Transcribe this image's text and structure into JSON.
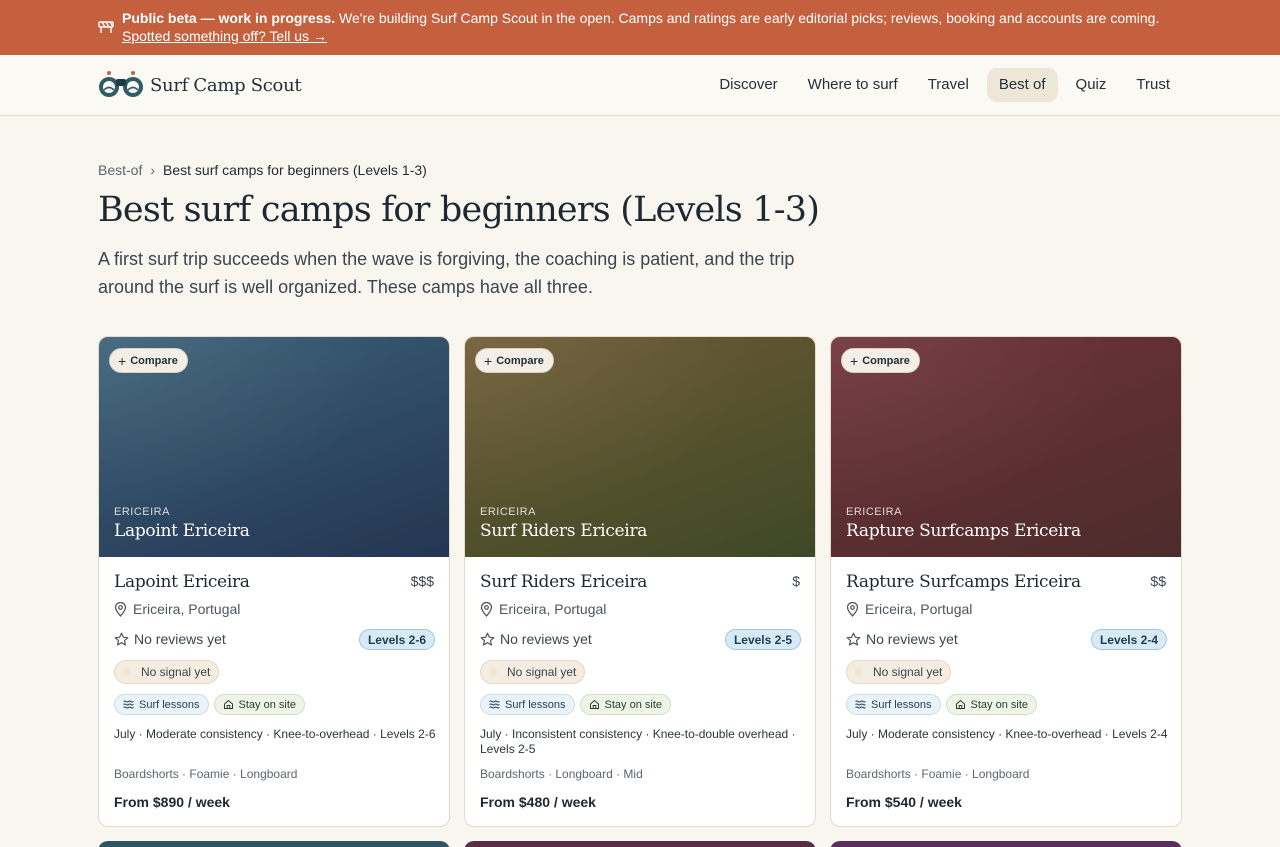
{
  "beta": {
    "icon": "construction-barrier-icon",
    "bold": "Public beta — work in progress.",
    "text": " We're building Surf Camp Scout in the open. Camps and ratings are early editorial picks; reviews, booking and accounts are coming.",
    "link": "Spotted something off? Tell us →",
    "bg": "#c5603f"
  },
  "brand": {
    "name": "Surf Camp Scout",
    "icon": "binoculars-logo-icon"
  },
  "nav": {
    "items": [
      {
        "label": "Discover",
        "active": false
      },
      {
        "label": "Where to surf",
        "active": false
      },
      {
        "label": "Travel",
        "active": false
      },
      {
        "label": "Best of",
        "active": true
      },
      {
        "label": "Quiz",
        "active": false
      },
      {
        "label": "Trust",
        "active": false
      }
    ]
  },
  "breadcrumb": {
    "root": "Best-of",
    "sep": "›",
    "current": "Best surf camps for beginners (Levels 1-3)"
  },
  "page": {
    "title": "Best surf camps for beginners (Levels 1-3)",
    "lede": "A first surf trip succeeds when the wave is forgiving, the coaching is patient, and the trip around the surf is well organized. These camps have all three."
  },
  "compare_label": "Compare",
  "cards": [
    {
      "region": "ERICEIRA",
      "name": "Lapoint Ericeira",
      "price": "$$$",
      "location": "Ericeira, Portugal",
      "reviews": "No reviews yet",
      "levels": "Levels 2-6",
      "signal": "No signal yet",
      "tag1": "Surf lessons",
      "tag2": "Stay on site",
      "meta": "July · Moderate consistency · Knee-to-overhead · Levels 2-6",
      "boards": "Boardshorts · Foamie · Longboard",
      "from": "From $890 / week",
      "colors": [
        "#3a6078",
        "#243552"
      ]
    },
    {
      "region": "ERICEIRA",
      "name": "Surf Riders Ericeira",
      "price": "$",
      "location": "Ericeira, Portugal",
      "reviews": "No reviews yet",
      "levels": "Levels 2-5",
      "signal": "No signal yet",
      "tag1": "Surf lessons",
      "tag2": "Stay on site",
      "meta": "July · Inconsistent consistency · Knee-to-double overhead · Levels 2-5",
      "boards": "Boardshorts · Longboard · Mid",
      "from": "From $480 / week",
      "colors": [
        "#6e5a34",
        "#3e4826"
      ]
    },
    {
      "region": "ERICEIRA",
      "name": "Rapture Surfcamps Ericeira",
      "price": "$$",
      "location": "Ericeira, Portugal",
      "reviews": "No reviews yet",
      "levels": "Levels 2-4",
      "signal": "No signal yet",
      "tag1": "Surf lessons",
      "tag2": "Stay on site",
      "meta": "July · Moderate consistency · Knee-to-overhead · Levels 2-4",
      "boards": "Boardshorts · Foamie · Longboard",
      "from": "From $540 / week",
      "colors": [
        "#6e3238",
        "#4d2c2c"
      ]
    }
  ],
  "next_row_colors": [
    "#2f5563",
    "#5a2e42",
    "#5b2e5e"
  ]
}
